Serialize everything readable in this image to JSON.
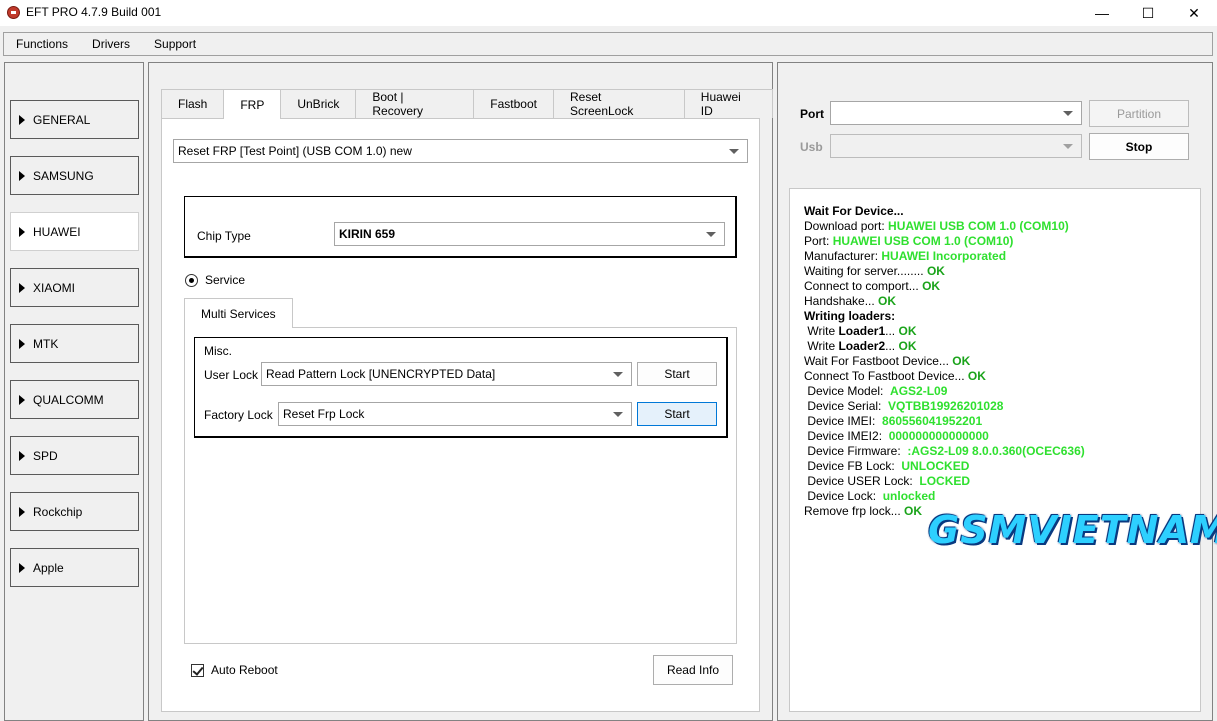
{
  "window": {
    "title": "EFT PRO 4.7.9 Build 001",
    "minimize_glyph": "—",
    "maximize_glyph": "☐",
    "close_glyph": "✕"
  },
  "menu": [
    "Functions",
    "Drivers",
    "Support"
  ],
  "sidebar": {
    "items": [
      "GENERAL",
      "SAMSUNG",
      "HUAWEI",
      "XIAOMI",
      "MTK",
      "QUALCOMM",
      "SPD",
      "Rockchip",
      "Apple"
    ],
    "selected": "HUAWEI"
  },
  "tabs": [
    "Flash",
    "FRP",
    "UnBrick",
    "Boot | Recovery",
    "Fastboot",
    "Reset ScreenLock",
    "Huawei ID"
  ],
  "active_tab": "FRP",
  "frp": {
    "mode_select": "Reset FRP [Test Point] (USB COM 1.0) new",
    "chip_type_label": "Chip Type",
    "chip_type_value": "KIRIN 659",
    "service_label": "Service",
    "subtab": "Multi Services",
    "misc_label": "Misc.",
    "user_lock_label": "User Lock",
    "user_lock_value": "Read Pattern Lock [UNENCRYPTED Data]",
    "factory_lock_label": "Factory Lock",
    "factory_lock_value": "Reset Frp Lock",
    "start_label": "Start",
    "start2_label": "Start",
    "auto_reboot_label": "Auto Reboot",
    "read_info_label": "Read Info"
  },
  "connection": {
    "port_label": "Port",
    "usb_label": "Usb",
    "partition_label": "Partition",
    "stop_label": "Stop"
  },
  "log": {
    "l1": "Wait For Device...",
    "l2a": "Download port: ",
    "l2b": "HUAWEI USB COM 1.0 (COM10)",
    "l3a": "Port: ",
    "l3b": "HUAWEI USB COM 1.0 (COM10)",
    "l4a": "Manufacturer: ",
    "l4b": "HUAWEI Incorporated",
    "l5a": "Waiting for server........ ",
    "l5b": "OK",
    "l6a": "Connect to comport... ",
    "l6b": "OK",
    "l7a": "Handshake... ",
    "l7b": "OK",
    "l8": "Writing loaders:",
    "l9a": " Write ",
    "l9b": "Loader1",
    "l9c": "... ",
    "l9d": "OK",
    "l10a": " Write ",
    "l10b": "Loader2",
    "l10c": "... ",
    "l10d": "OK",
    "l11a": "Wait For Fastboot Device... ",
    "l11b": "OK",
    "l12a": "Connect To Fastboot Device... ",
    "l12b": "OK",
    "l13a": " Device Model:  ",
    "l13b": "AGS2-L09",
    "l14a": " Device Serial:  ",
    "l14b": "VQTBB19926201028",
    "l15a": " Device IMEI:  ",
    "l15b": "860556041952201",
    "l16a": " Device IMEI2:  ",
    "l16b": "000000000000000",
    "l17a": " Device Firmware:  ",
    "l17b": ":AGS2-L09 8.0.0.360(OCEC636)",
    "l18a": " Device FB Lock:  ",
    "l18b": "UNLOCKED",
    "l19a": " Device USER Lock:  ",
    "l19b": "LOCKED",
    "l20a": " Device Lock:  ",
    "l20b": "unlocked",
    "l21a": "Remove frp lock... ",
    "l21b": "OK"
  },
  "watermark": "GSMVIETNAM",
  "colors": {
    "ok": "#1aa31a",
    "value_green": "#2fe02f",
    "watermark": "#2dd0ff"
  }
}
